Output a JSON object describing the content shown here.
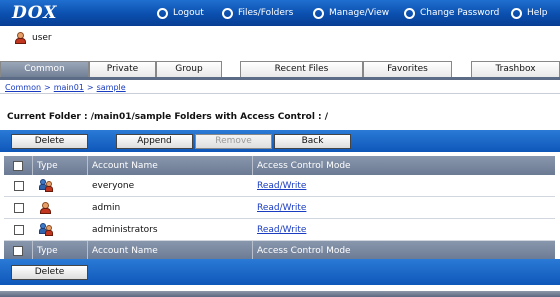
{
  "app": {
    "logo": "DOX"
  },
  "topnav": [
    {
      "label": "Logout",
      "icon": "logout-icon"
    },
    {
      "label": "Files/Folders",
      "icon": "files-folders-icon"
    },
    {
      "label": "Manage/View",
      "icon": "manage-view-icon"
    },
    {
      "label": "Change Password",
      "icon": "change-password-icon"
    },
    {
      "label": "Help",
      "icon": "help-icon"
    }
  ],
  "user": {
    "name": "user"
  },
  "tabs": {
    "common": "Common",
    "private": "Private",
    "group": "Group",
    "recent": "Recent Files",
    "favorites": "Favorites",
    "trashbox": "Trashbox"
  },
  "breadcrumb": [
    "Common",
    "main01",
    "sample"
  ],
  "current_folder": "Current Folder : /main01/sample  Folders with Access Control : /",
  "toolbar": {
    "delete": "Delete",
    "append": "Append",
    "remove": "Remove",
    "back": "Back"
  },
  "table": {
    "headers": {
      "type": "Type",
      "account": "Account Name",
      "mode": "Access Control Mode"
    },
    "rows": [
      {
        "icon": "group-icon",
        "account": "everyone",
        "mode": "Read/Write"
      },
      {
        "icon": "user-icon",
        "account": "admin",
        "mode": "Read/Write"
      },
      {
        "icon": "group-icon",
        "account": "administrators",
        "mode": "Read/Write"
      }
    ]
  },
  "footer": {
    "delete": "Delete"
  },
  "colors": {
    "bar_blue": "#0e57b9",
    "tab_active": "#6f7d93",
    "link": "#1a3cc0"
  }
}
